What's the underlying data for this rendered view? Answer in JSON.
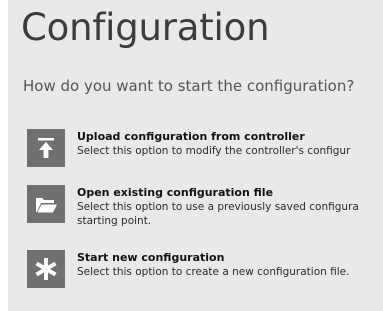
{
  "page": {
    "title": "Configuration",
    "question": "How do you want to start the configuration?"
  },
  "options": [
    {
      "icon": "upload-icon",
      "title": "Upload configuration from controller",
      "description": "Select this option to modify the controller's configur"
    },
    {
      "icon": "folder-open-icon",
      "title": "Open existing configuration file",
      "description": "Select this option to use a previously saved configura",
      "description_line2": "starting point."
    },
    {
      "icon": "asterisk-icon",
      "title": "Start new configuration",
      "description": "Select this option to create a new configuration file."
    }
  ],
  "colors": {
    "panel_background": "#e9e9e9",
    "icon_tile": "#707070",
    "icon_glyph": "#ffffff"
  }
}
